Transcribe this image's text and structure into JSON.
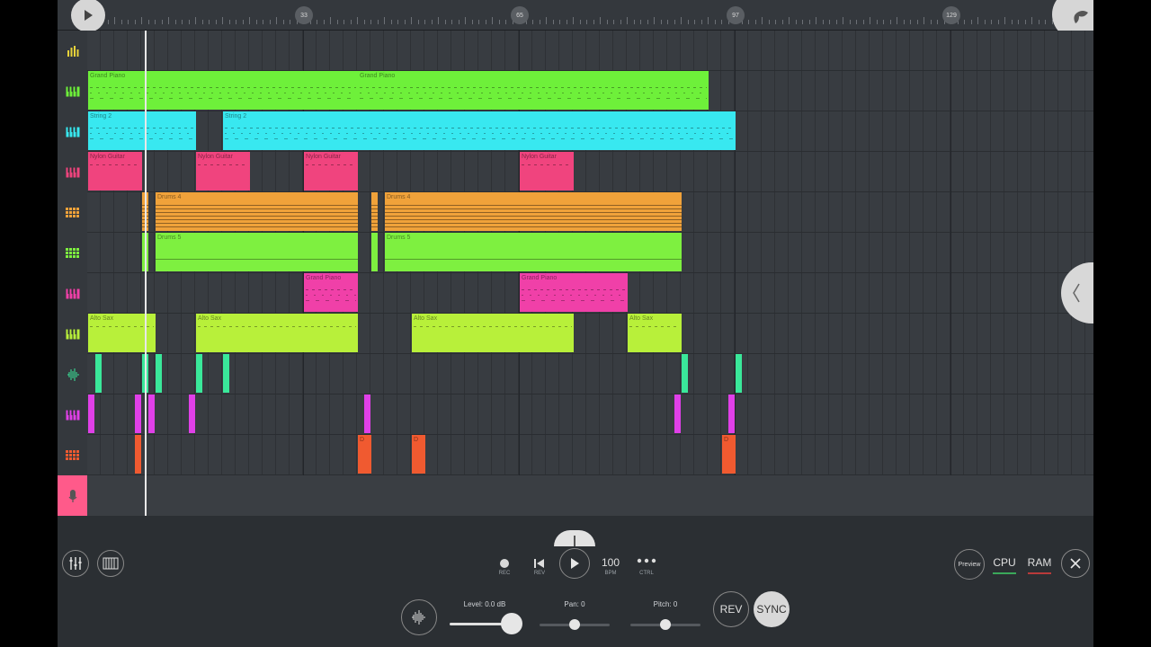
{
  "ruler": {
    "markers": [
      "33",
      "65",
      "97",
      "129"
    ]
  },
  "tracks": [
    {
      "icon": "bar-chart-icon",
      "color": "#e8d33a"
    },
    {
      "icon": "piano-keys-icon",
      "color": "#6ef03a"
    },
    {
      "icon": "piano-keys-icon",
      "color": "#38e8f0"
    },
    {
      "icon": "piano-keys-icon",
      "color": "#f0447e"
    },
    {
      "icon": "step-sequencer-icon",
      "color": "#f0a23a"
    },
    {
      "icon": "step-sequencer-icon",
      "color": "#7ef040"
    },
    {
      "icon": "piano-keys-icon",
      "color": "#f040a8"
    },
    {
      "icon": "piano-keys-icon",
      "color": "#b8f03a"
    },
    {
      "icon": "waveform-icon",
      "color": "#3ae89a"
    },
    {
      "icon": "piano-keys-icon",
      "color": "#e040e8"
    },
    {
      "icon": "step-sequencer-icon",
      "color": "#f05a30"
    },
    {
      "icon": "microphone-icon",
      "color": "#ff5a8a"
    }
  ],
  "clip_names": {
    "grand_piano": "Grand Piano",
    "string2": "String 2",
    "nylon_guitar": "Nylon Guitar",
    "drums4": "Drums 4",
    "drums5": "Drums 5",
    "alto_sax": "Alto Sax",
    "d": "D"
  },
  "transport": {
    "rec_label": "REC",
    "rev_label": "REV",
    "bpm_value": "100",
    "bpm_label": "BPM",
    "ctrl_label": "CTRL",
    "ctrl_icon": "more-dots-icon"
  },
  "right_controls": {
    "preview_label": "Preview",
    "cpu_label": "CPU",
    "ram_label": "RAM"
  },
  "sample_controls": {
    "level_label": "Level: 0.0 dB",
    "level_value": 0.88,
    "pan_label": "Pan: 0",
    "pan_value": 0.5,
    "pitch_label": "Pitch: 0",
    "pitch_value": 0.5,
    "rev_button": "REV",
    "sync_button": "SYNC"
  }
}
